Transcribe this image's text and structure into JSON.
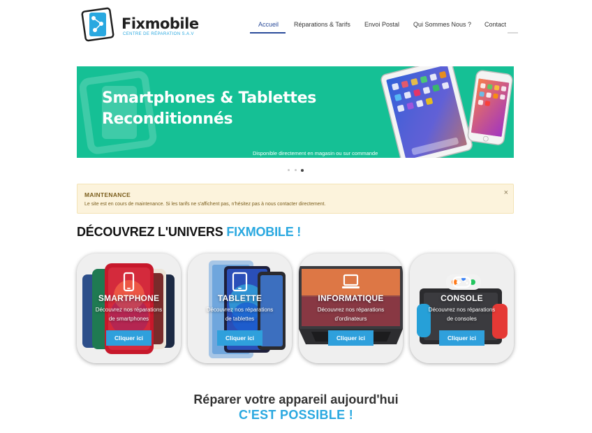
{
  "brand": {
    "name": "Fixmobile",
    "tagline": "CENTRE DE RÉPARATION S.A.V"
  },
  "nav": {
    "items": [
      {
        "label": "Accueil",
        "active": true
      },
      {
        "label": "Réparations & Tarifs"
      },
      {
        "label": "Envoi Postal"
      },
      {
        "label": "Qui Sommes Nous ?"
      },
      {
        "label": "Contact"
      }
    ]
  },
  "banner": {
    "title_line1": "Smartphones & Tablettes",
    "title_line2": "Reconditionnés",
    "subtitle": "Disponible directement en magasin ou sur commande",
    "background": "#15c095",
    "slides_total": 3,
    "active_slide": 3
  },
  "alert": {
    "title": "MAINTENANCE",
    "text": "Le site est en cours de maintenance. Si les tarifs ne s'affichent pas, n'hésitez pas à nous contacter directement.",
    "close": "×"
  },
  "section": {
    "heading_prefix": "DÉCOUVREZ L'UNIVERS ",
    "heading_accent": "FIXMOBILE !"
  },
  "cards": [
    {
      "icon": "smartphone-icon",
      "title": "SMARTPHONE",
      "desc_line1": "Découvrez nos réparations",
      "desc_line2": "de smartphones",
      "button": "Cliquer ici"
    },
    {
      "icon": "tablet-icon",
      "title": "TABLETTE",
      "desc_line1": "Découvrez nos réparations",
      "desc_line2": "de tablettes",
      "button": "Cliquer ici"
    },
    {
      "icon": "laptop-icon",
      "title": "INFORMATIQUE",
      "desc_line1": "Découvrez nos réparations",
      "desc_line2": "d'ordinateurs",
      "button": "Cliquer ici"
    },
    {
      "icon": "gamepad-icon",
      "title": "CONSOLE",
      "desc_line1": "Découvrez nos réparations",
      "desc_line2": "de consoles",
      "button": "Cliquer ici"
    }
  ],
  "closing": {
    "line1": "Réparer votre appareil aujourd'hui",
    "line2": "C'EST POSSIBLE !"
  },
  "colors": {
    "accent": "#29a8e0",
    "nav_active": "#2b4c9a",
    "button": "#2fa0dc",
    "alert_bg": "#fcf3dc"
  }
}
